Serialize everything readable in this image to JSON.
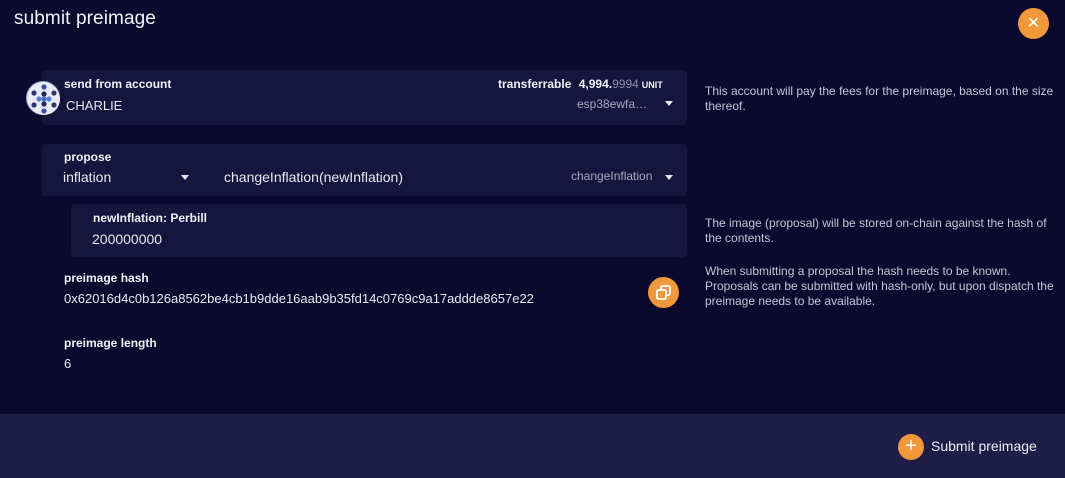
{
  "modal": {
    "title": "submit preimage",
    "close_icon": "close-icon"
  },
  "account": {
    "label": "send from account",
    "name": "CHARLIE",
    "transferrable_label": "transferrable",
    "balance_int": "4,994.",
    "balance_dec": "9994",
    "balance_unit": "UNIT",
    "address_short": "esp38ewfa…",
    "help": "This account will pay the fees for the preimage, based on the size thereof."
  },
  "propose": {
    "label": "propose",
    "section": "inflation",
    "call": "changeInflation(newInflation)",
    "method": "changeInflation"
  },
  "param": {
    "label": "newInflation: Perbill",
    "value": "200000000"
  },
  "param_help": "The image (proposal) will be stored on-chain against the hash of the contents.",
  "hash": {
    "label": "preimage hash",
    "value": "0x62016d4c0b126a8562be4cb1b9dde16aab9b35fd14c0769c9a17addde8657e22",
    "help": "When submitting a proposal the hash needs to be known. Proposals can be submitted with hash-only, but upon dispatch the preimage needs to be available."
  },
  "length": {
    "label": "preimage length",
    "value": "6"
  },
  "footer": {
    "submit_label": "Submit preimage"
  },
  "colors": {
    "background": "#0b0a2e",
    "panel": "#16153d",
    "footer": "#1e1d47",
    "accent": "#f1983a"
  }
}
